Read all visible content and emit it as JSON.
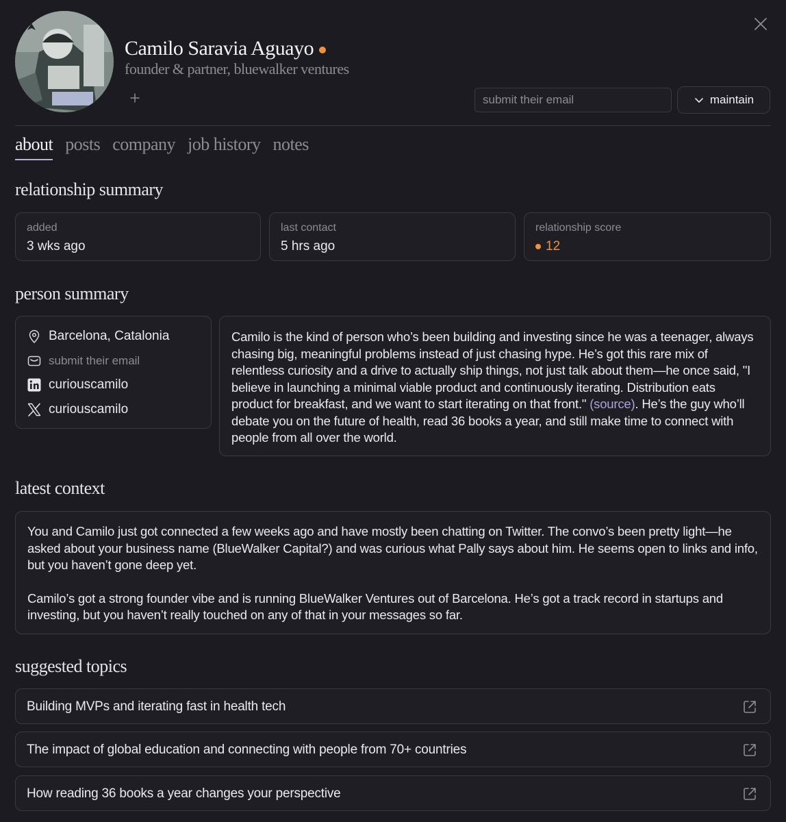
{
  "profile": {
    "name": "Camilo Saravia Aguayo",
    "subtitle": "founder & partner, bluewalker ventures",
    "email_placeholder": "submit their email",
    "action_label": "maintain"
  },
  "tabs": [
    {
      "label": "about"
    },
    {
      "label": "posts"
    },
    {
      "label": "company"
    },
    {
      "label": "job history"
    },
    {
      "label": "notes"
    }
  ],
  "relationship_summary": {
    "title": "relationship summary",
    "added_label": "added",
    "added_value": "3 wks ago",
    "last_contact_label": "last contact",
    "last_contact_value": "5 hrs ago",
    "score_label": "relationship score",
    "score_value": "12"
  },
  "person_summary": {
    "title": "person summary",
    "location": "Barcelona, Catalonia",
    "email_prompt": "submit their email",
    "linkedin": "curiouscamilo",
    "x_handle": "curiouscamilo",
    "bio_before": "Camilo is the kind of person who’s been building and investing since he was a teenager, always chasing big, meaningful problems instead of just chasing hype. He’s got this rare mix of relentless curiosity and a drive to actually ship things, not just talk about them—he once said, \"I believe in launching a minimal viable product and continuously iterating. Distribution eats product for breakfast, and we want to start iterating on that front.\" ",
    "bio_link": "(source)",
    "bio_after": ". He’s the guy who’ll debate you on the future of health, read 36 books a year, and still make time to connect with people from all over the world."
  },
  "latest_context": {
    "title": "latest context",
    "paragraph_1": "You and Camilo just got connected a few weeks ago and have mostly been chatting on Twitter. The convo’s been pretty light—he asked about your business name (BlueWalker Capital?) and was curious what Pally says about him. He seems open to links and info, but you haven’t gone deep yet.",
    "paragraph_2": "Camilo’s got a strong founder vibe and is running BlueWalker Ventures out of Barcelona. He’s got a track record in startups and investing, but you haven’t really touched on any of that in your messages so far."
  },
  "suggested_topics": {
    "title": "suggested topics",
    "items": [
      {
        "label": "Building MVPs and iterating fast in health tech"
      },
      {
        "label": "The impact of global education and connecting with people from 70+ countries"
      },
      {
        "label": "How reading 36 books a year changes your perspective"
      }
    ]
  },
  "colors": {
    "background": "#1c1b21",
    "card": "#1f1e24",
    "border": "#3a3940",
    "accent_orange": "#f0913c",
    "link": "#a9a4d8"
  },
  "icons": [
    "close-icon",
    "plus-icon",
    "chevron-down-icon",
    "location-pin-icon",
    "mail-icon",
    "linkedin-icon",
    "x-icon",
    "external-link-icon"
  ]
}
